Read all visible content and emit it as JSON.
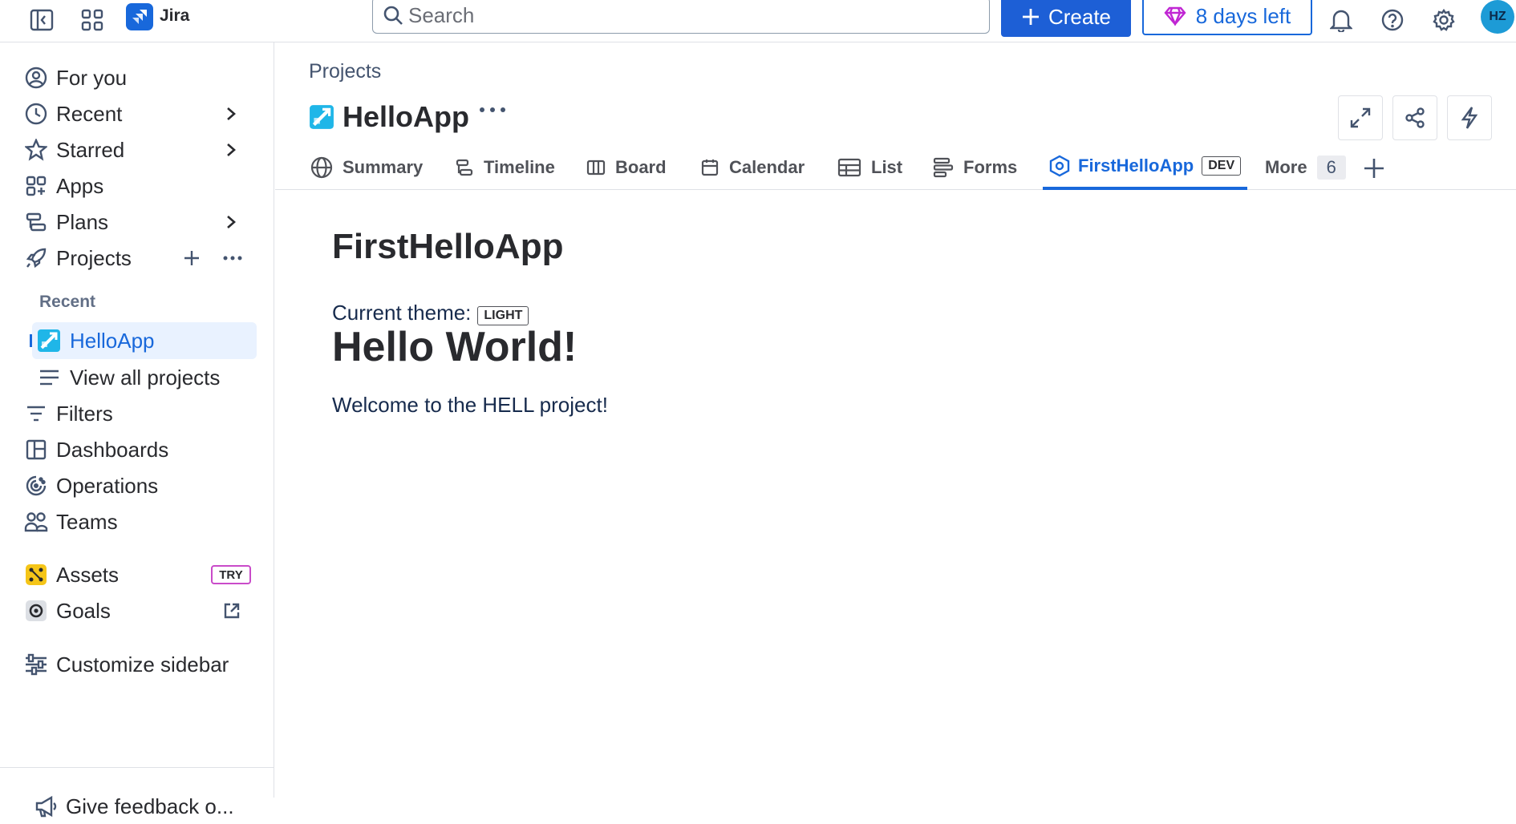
{
  "topbar": {
    "app_name": "Jira",
    "search_placeholder": "Search",
    "create_label": "Create",
    "trial_label": "8 days left",
    "avatar_initials": "HZ",
    "accent": "#1868db",
    "icons": [
      "sidebar-toggle-icon",
      "app-switcher-icon",
      "jira-logo",
      "search-icon",
      "plus-icon",
      "gem-icon",
      "bell-icon",
      "help-icon",
      "gear-icon"
    ]
  },
  "sidebar": {
    "items": [
      {
        "label": "For you"
      },
      {
        "label": "Recent"
      },
      {
        "label": "Starred"
      },
      {
        "label": "Apps"
      },
      {
        "label": "Plans"
      },
      {
        "label": "Projects"
      }
    ],
    "recent_label": "Recent",
    "recent_projects": [
      {
        "label": "HelloApp"
      },
      {
        "label": "View all projects"
      }
    ],
    "items2": [
      {
        "label": "Filters"
      },
      {
        "label": "Dashboards"
      },
      {
        "label": "Operations"
      },
      {
        "label": "Teams"
      }
    ],
    "assets_label": "Assets",
    "assets_badge": "TRY",
    "goals_label": "Goals",
    "customize_label": "Customize sidebar",
    "feedback_label": "Give feedback o..."
  },
  "main": {
    "breadcrumb": "Projects",
    "project_name": "HelloApp",
    "tabs": [
      {
        "label": "Summary"
      },
      {
        "label": "Timeline"
      },
      {
        "label": "Board"
      },
      {
        "label": "Calendar"
      },
      {
        "label": "List"
      },
      {
        "label": "Forms"
      },
      {
        "label": "FirstHelloApp",
        "badge": "DEV"
      },
      {
        "label": "More",
        "count": "6"
      }
    ],
    "app_title": "FirstHelloApp",
    "theme_label": "Current theme:",
    "theme_value": "LIGHT",
    "hello": "Hello World!",
    "welcome": "Welcome to the HELL project!"
  }
}
